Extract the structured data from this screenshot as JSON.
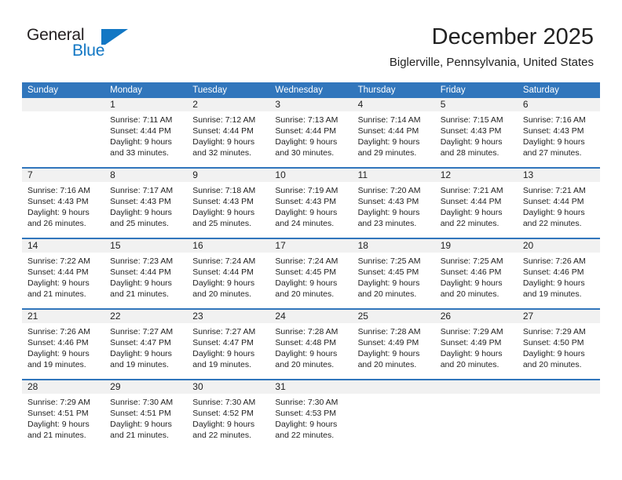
{
  "brand": {
    "name_top": "General",
    "name_bottom": "Blue",
    "mark_icon": "pennant-triangle-icon",
    "color_primary": "#1277c4",
    "color_text": "#231f20"
  },
  "header": {
    "title": "December 2025",
    "subtitle": "Biglerville, Pennsylvania, United States"
  },
  "theme": {
    "header_blue": "#3176bc",
    "day_band_gray": "#f1f1f1",
    "text": "#222222"
  },
  "weekdays": [
    "Sunday",
    "Monday",
    "Tuesday",
    "Wednesday",
    "Thursday",
    "Friday",
    "Saturday"
  ],
  "weeks": [
    [
      {
        "date": "",
        "sunrise": "",
        "sunset": "",
        "daylight": ""
      },
      {
        "date": "1",
        "sunrise": "Sunrise: 7:11 AM",
        "sunset": "Sunset: 4:44 PM",
        "daylight": "Daylight: 9 hours and 33 minutes."
      },
      {
        "date": "2",
        "sunrise": "Sunrise: 7:12 AM",
        "sunset": "Sunset: 4:44 PM",
        "daylight": "Daylight: 9 hours and 32 minutes."
      },
      {
        "date": "3",
        "sunrise": "Sunrise: 7:13 AM",
        "sunset": "Sunset: 4:44 PM",
        "daylight": "Daylight: 9 hours and 30 minutes."
      },
      {
        "date": "4",
        "sunrise": "Sunrise: 7:14 AM",
        "sunset": "Sunset: 4:44 PM",
        "daylight": "Daylight: 9 hours and 29 minutes."
      },
      {
        "date": "5",
        "sunrise": "Sunrise: 7:15 AM",
        "sunset": "Sunset: 4:43 PM",
        "daylight": "Daylight: 9 hours and 28 minutes."
      },
      {
        "date": "6",
        "sunrise": "Sunrise: 7:16 AM",
        "sunset": "Sunset: 4:43 PM",
        "daylight": "Daylight: 9 hours and 27 minutes."
      }
    ],
    [
      {
        "date": "7",
        "sunrise": "Sunrise: 7:16 AM",
        "sunset": "Sunset: 4:43 PM",
        "daylight": "Daylight: 9 hours and 26 minutes."
      },
      {
        "date": "8",
        "sunrise": "Sunrise: 7:17 AM",
        "sunset": "Sunset: 4:43 PM",
        "daylight": "Daylight: 9 hours and 25 minutes."
      },
      {
        "date": "9",
        "sunrise": "Sunrise: 7:18 AM",
        "sunset": "Sunset: 4:43 PM",
        "daylight": "Daylight: 9 hours and 25 minutes."
      },
      {
        "date": "10",
        "sunrise": "Sunrise: 7:19 AM",
        "sunset": "Sunset: 4:43 PM",
        "daylight": "Daylight: 9 hours and 24 minutes."
      },
      {
        "date": "11",
        "sunrise": "Sunrise: 7:20 AM",
        "sunset": "Sunset: 4:43 PM",
        "daylight": "Daylight: 9 hours and 23 minutes."
      },
      {
        "date": "12",
        "sunrise": "Sunrise: 7:21 AM",
        "sunset": "Sunset: 4:44 PM",
        "daylight": "Daylight: 9 hours and 22 minutes."
      },
      {
        "date": "13",
        "sunrise": "Sunrise: 7:21 AM",
        "sunset": "Sunset: 4:44 PM",
        "daylight": "Daylight: 9 hours and 22 minutes."
      }
    ],
    [
      {
        "date": "14",
        "sunrise": "Sunrise: 7:22 AM",
        "sunset": "Sunset: 4:44 PM",
        "daylight": "Daylight: 9 hours and 21 minutes."
      },
      {
        "date": "15",
        "sunrise": "Sunrise: 7:23 AM",
        "sunset": "Sunset: 4:44 PM",
        "daylight": "Daylight: 9 hours and 21 minutes."
      },
      {
        "date": "16",
        "sunrise": "Sunrise: 7:24 AM",
        "sunset": "Sunset: 4:44 PM",
        "daylight": "Daylight: 9 hours and 20 minutes."
      },
      {
        "date": "17",
        "sunrise": "Sunrise: 7:24 AM",
        "sunset": "Sunset: 4:45 PM",
        "daylight": "Daylight: 9 hours and 20 minutes."
      },
      {
        "date": "18",
        "sunrise": "Sunrise: 7:25 AM",
        "sunset": "Sunset: 4:45 PM",
        "daylight": "Daylight: 9 hours and 20 minutes."
      },
      {
        "date": "19",
        "sunrise": "Sunrise: 7:25 AM",
        "sunset": "Sunset: 4:46 PM",
        "daylight": "Daylight: 9 hours and 20 minutes."
      },
      {
        "date": "20",
        "sunrise": "Sunrise: 7:26 AM",
        "sunset": "Sunset: 4:46 PM",
        "daylight": "Daylight: 9 hours and 19 minutes."
      }
    ],
    [
      {
        "date": "21",
        "sunrise": "Sunrise: 7:26 AM",
        "sunset": "Sunset: 4:46 PM",
        "daylight": "Daylight: 9 hours and 19 minutes."
      },
      {
        "date": "22",
        "sunrise": "Sunrise: 7:27 AM",
        "sunset": "Sunset: 4:47 PM",
        "daylight": "Daylight: 9 hours and 19 minutes."
      },
      {
        "date": "23",
        "sunrise": "Sunrise: 7:27 AM",
        "sunset": "Sunset: 4:47 PM",
        "daylight": "Daylight: 9 hours and 19 minutes."
      },
      {
        "date": "24",
        "sunrise": "Sunrise: 7:28 AM",
        "sunset": "Sunset: 4:48 PM",
        "daylight": "Daylight: 9 hours and 20 minutes."
      },
      {
        "date": "25",
        "sunrise": "Sunrise: 7:28 AM",
        "sunset": "Sunset: 4:49 PM",
        "daylight": "Daylight: 9 hours and 20 minutes."
      },
      {
        "date": "26",
        "sunrise": "Sunrise: 7:29 AM",
        "sunset": "Sunset: 4:49 PM",
        "daylight": "Daylight: 9 hours and 20 minutes."
      },
      {
        "date": "27",
        "sunrise": "Sunrise: 7:29 AM",
        "sunset": "Sunset: 4:50 PM",
        "daylight": "Daylight: 9 hours and 20 minutes."
      }
    ],
    [
      {
        "date": "28",
        "sunrise": "Sunrise: 7:29 AM",
        "sunset": "Sunset: 4:51 PM",
        "daylight": "Daylight: 9 hours and 21 minutes."
      },
      {
        "date": "29",
        "sunrise": "Sunrise: 7:30 AM",
        "sunset": "Sunset: 4:51 PM",
        "daylight": "Daylight: 9 hours and 21 minutes."
      },
      {
        "date": "30",
        "sunrise": "Sunrise: 7:30 AM",
        "sunset": "Sunset: 4:52 PM",
        "daylight": "Daylight: 9 hours and 22 minutes."
      },
      {
        "date": "31",
        "sunrise": "Sunrise: 7:30 AM",
        "sunset": "Sunset: 4:53 PM",
        "daylight": "Daylight: 9 hours and 22 minutes."
      },
      {
        "date": "",
        "sunrise": "",
        "sunset": "",
        "daylight": ""
      },
      {
        "date": "",
        "sunrise": "",
        "sunset": "",
        "daylight": ""
      },
      {
        "date": "",
        "sunrise": "",
        "sunset": "",
        "daylight": ""
      }
    ]
  ]
}
